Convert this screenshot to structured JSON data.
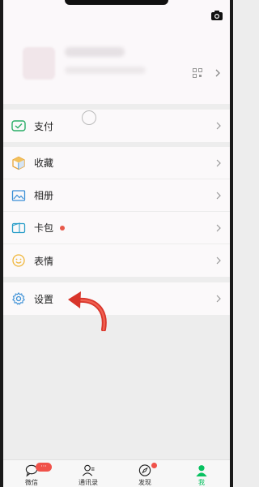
{
  "sections": {
    "pay": {
      "label": "支付"
    },
    "favorites": {
      "label": "收藏"
    },
    "album": {
      "label": "相册"
    },
    "cards": {
      "label": "卡包",
      "has_dot": true
    },
    "stickers": {
      "label": "表情"
    },
    "settings": {
      "label": "设置"
    }
  },
  "tabbar": {
    "chats": {
      "label": "微信",
      "badge": "···"
    },
    "contacts": {
      "label": "通讯录"
    },
    "discover": {
      "label": "发现"
    },
    "me": {
      "label": "我"
    }
  },
  "colors": {
    "accent": "#07c160",
    "badge": "#f0524a",
    "annotation_arrow": "#e0392a"
  },
  "icons": [
    "camera-icon",
    "qr-code-icon",
    "pay-icon",
    "favorites-icon",
    "album-icon",
    "cards-icon",
    "stickers-icon",
    "settings-gear-icon",
    "chevron-right-icon"
  ]
}
